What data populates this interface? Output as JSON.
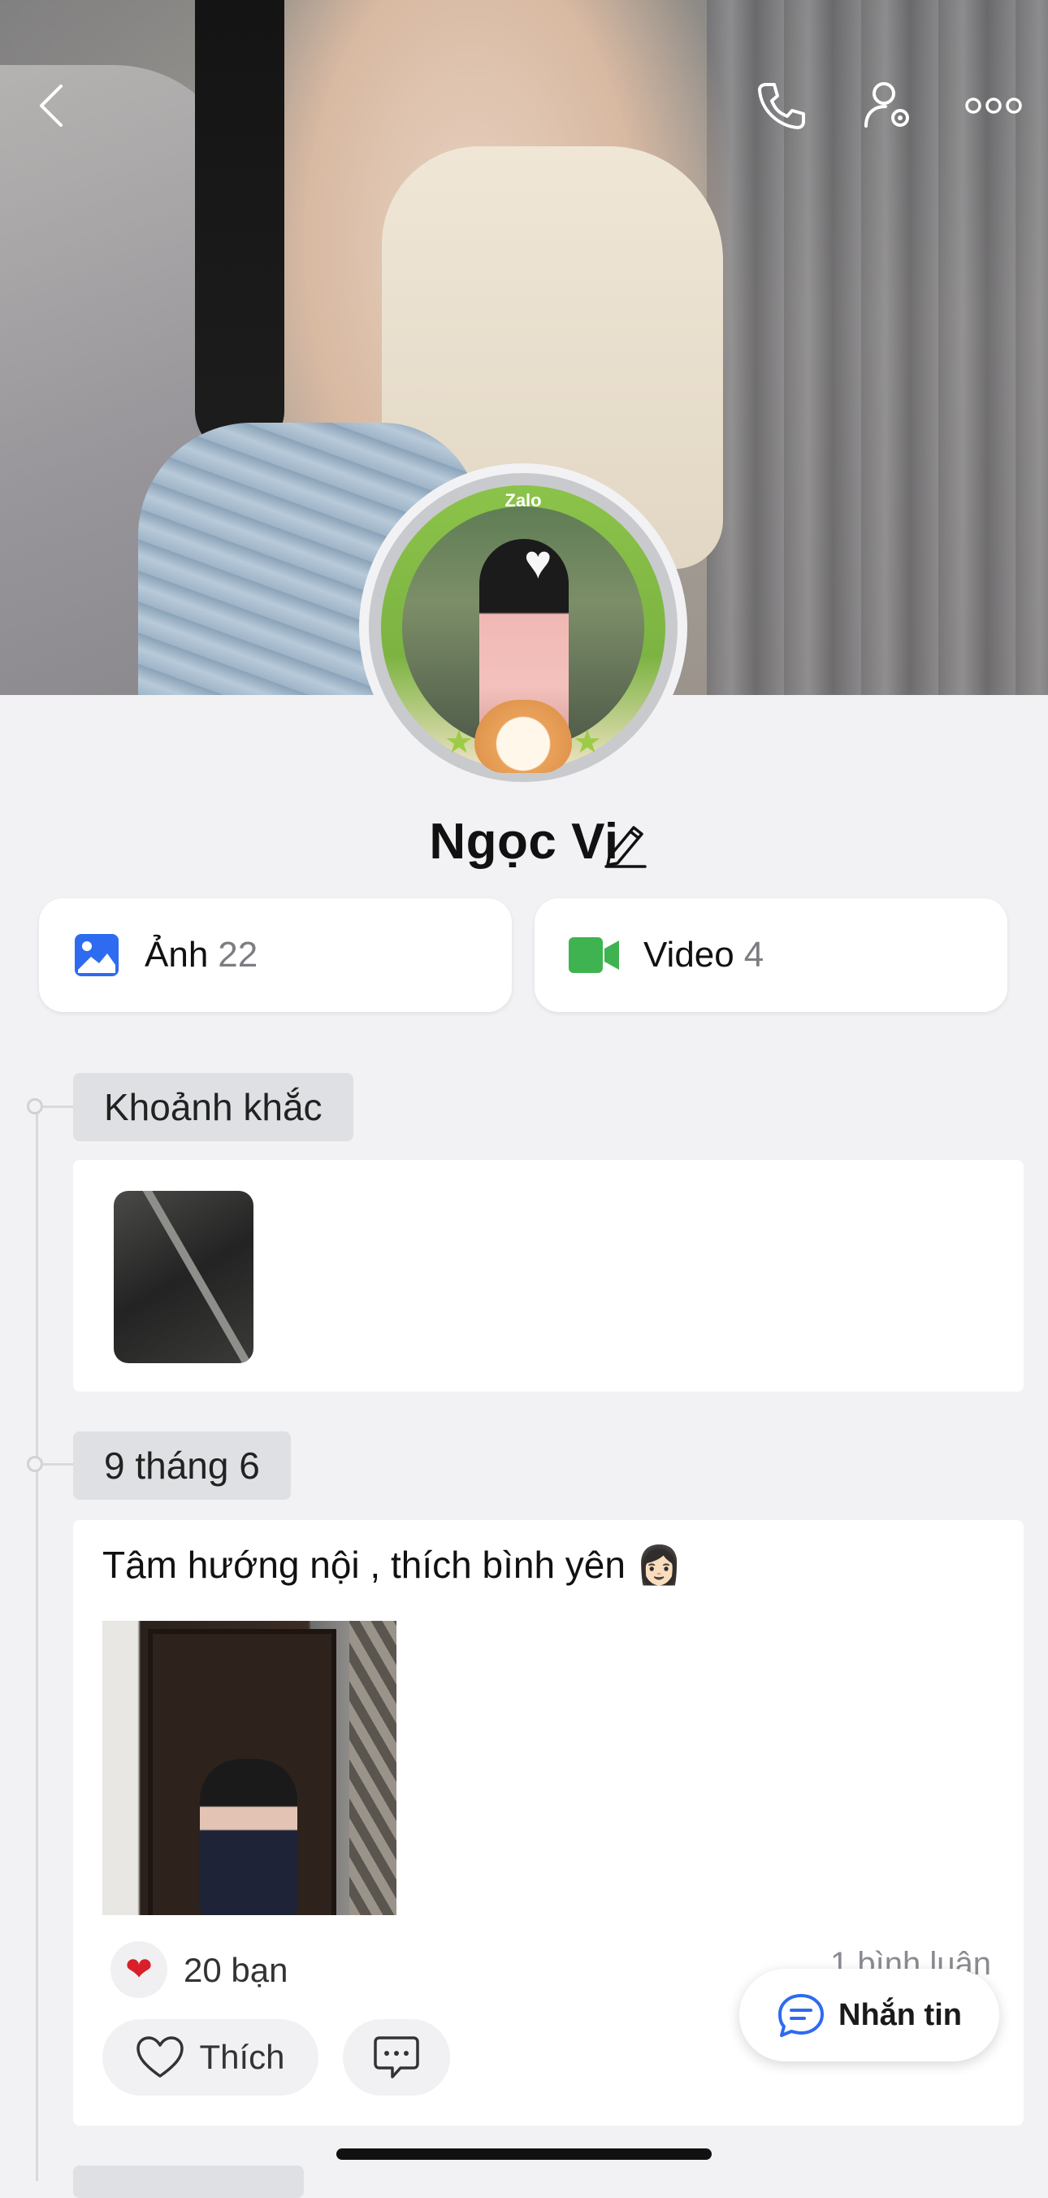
{
  "header": {
    "back_icon": "chevron-left-icon",
    "call_icon": "phone-icon",
    "settings_icon": "user-gear-icon",
    "more_icon": "more-dots-icon"
  },
  "profile": {
    "avatar_badge": "Zalo",
    "name": "Ngọc Vi",
    "edit_icon": "pencil-icon"
  },
  "media": [
    {
      "label": "Ảnh",
      "count": "22",
      "icon": "photo-icon",
      "color": "#2f6bf0"
    },
    {
      "label": "Video",
      "count": "4",
      "icon": "video-camera-icon",
      "color": "#3fb34f"
    }
  ],
  "moments": {
    "title": "Khoảnh khắc"
  },
  "post": {
    "date": "9 tháng 6",
    "text": "Tâm hướng nội , thích bình yên 👩🏻",
    "reaction_emoji": "❤",
    "reaction_count": "20 bạn",
    "comment_count": "1 bình luận",
    "like_label": "Thích",
    "comment_icon": "comment-icon"
  },
  "fab": {
    "label": "Nhắn tin",
    "icon": "chat-bubble-icon",
    "accent": "#2f6bf0"
  }
}
